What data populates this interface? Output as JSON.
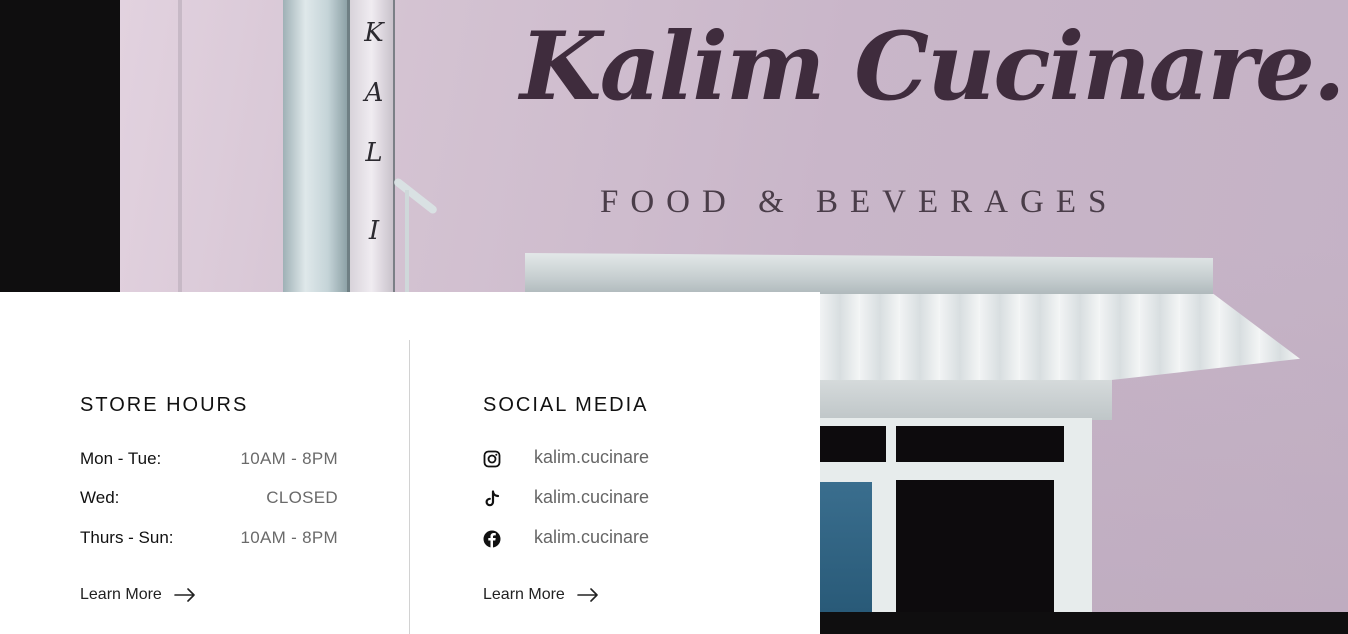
{
  "hero": {
    "brand_name": "Kalim Cucinare.",
    "brand_tagline": "FOOD & BEVERAGES",
    "sign_letters": [
      "K",
      "A",
      "L",
      "I"
    ]
  },
  "store_hours": {
    "title": "STORE HOURS",
    "rows": [
      {
        "day": "Mon - Tue:",
        "time": "10AM - 8PM"
      },
      {
        "day": "Wed:",
        "time": "CLOSED"
      },
      {
        "day": "Thurs - Sun:",
        "time": "10AM - 8PM"
      }
    ],
    "learn_more": "Learn More"
  },
  "social_media": {
    "title": "SOCIAL MEDIA",
    "items": [
      {
        "icon": "instagram-icon",
        "handle": "kalim.cucinare"
      },
      {
        "icon": "tiktok-icon",
        "handle": "kalim.cucinare"
      },
      {
        "icon": "facebook-icon",
        "handle": "kalim.cucinare"
      }
    ],
    "learn_more": "Learn More"
  },
  "colors": {
    "wall": "#c9b6c9",
    "brand_text": "#3f2c3d",
    "panel_bg": "#ffffff",
    "heading_text": "#111111",
    "muted_text": "#6a6a6a"
  }
}
